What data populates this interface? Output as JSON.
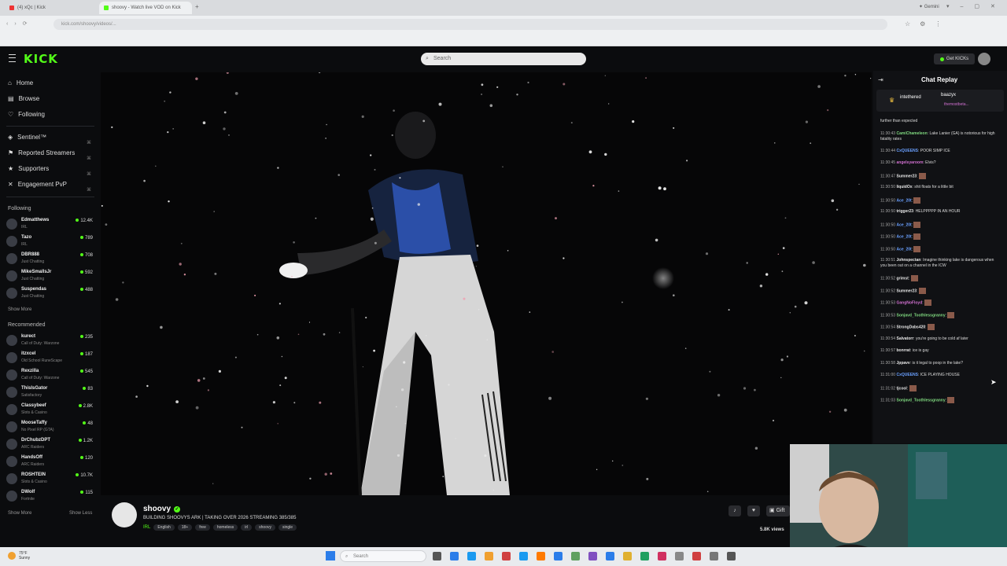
{
  "browser": {
    "tabs": [
      "(4) xQc | Kick",
      "shoovy - Watch live VOD on Kick"
    ],
    "profile": "Gemini",
    "url": "kick.com/shoovy/videos/..."
  },
  "header": {
    "logo": "KICK",
    "search_placeholder": "Search",
    "get_kicks": "Get KICKs"
  },
  "sidebar": {
    "nav": [
      {
        "label": "Home",
        "icon": "home-icon"
      },
      {
        "label": "Browse",
        "icon": "browse-icon"
      },
      {
        "label": "Following",
        "icon": "heart-icon"
      }
    ],
    "pinned": [
      {
        "label": "Sentinel™"
      },
      {
        "label": "Reported Streamers"
      },
      {
        "label": "Supporters"
      },
      {
        "label": "Engagement PvP"
      }
    ],
    "following_title": "Following",
    "following": [
      {
        "name": "Edmatthews",
        "category": "IRL",
        "viewers": "12.4K"
      },
      {
        "name": "Tazo",
        "category": "IRL",
        "viewers": "789"
      },
      {
        "name": "DBR888",
        "category": "Just Chatting",
        "viewers": "708"
      },
      {
        "name": "MikeSmallsJr",
        "category": "Just Chatting",
        "viewers": "592"
      },
      {
        "name": "Suspendas",
        "category": "Just Chatting",
        "viewers": "488"
      }
    ],
    "show_more": "Show More",
    "recommended_title": "Recommended",
    "recommended": [
      {
        "name": "kurect",
        "category": "Call of Duty: Warzone",
        "viewers": "235"
      },
      {
        "name": "itzxcel",
        "category": "Old School RuneScape",
        "viewers": "187"
      },
      {
        "name": "Rexzilla",
        "category": "Call of Duty: Warzone",
        "viewers": "545"
      },
      {
        "name": "ThisIsGator",
        "category": "Satisfactory",
        "viewers": "83"
      },
      {
        "name": "Classybeef",
        "category": "Slots & Casino",
        "viewers": "2.8K"
      },
      {
        "name": "MooseTaffy",
        "category": "No Pixel RP (GTA)",
        "viewers": "48"
      },
      {
        "name": "DrChubzDPT",
        "category": "ARC Raiders",
        "viewers": "1.2K"
      },
      {
        "name": "HandsOff",
        "category": "ARC Raiders",
        "viewers": "120"
      },
      {
        "name": "ROSHTEIN",
        "category": "Slots & Casino",
        "viewers": "10.7K"
      },
      {
        "name": "DWolf",
        "category": "Fortnite",
        "viewers": "115"
      }
    ],
    "show_more_2": "Show More",
    "show_less": "Show Less"
  },
  "stream": {
    "streamer": "shoovy",
    "title": "BUILDING SHOOVYS ARK | TAKING OVER 2026 STREAMING 385/385",
    "category": "IRL",
    "tags": [
      "English",
      "18+",
      "free",
      "homeless",
      "irl",
      "shoovy",
      "single"
    ],
    "views": "5.8K views",
    "gift": "Gift"
  },
  "chat": {
    "title": "Chat Replay",
    "pinned_users": [
      "intethered",
      "baazyx",
      "themostbeta..."
    ],
    "messages": [
      {
        "ts": "",
        "user": "",
        "text": "further than expected",
        "color": "#dddddd"
      },
      {
        "ts": "11:30:43",
        "user": "CamiChameleon",
        "text": "Lake Lanier (GA) is notorious for high fatality rates",
        "color": "#7fd87f"
      },
      {
        "ts": "11:30:44",
        "user": "CxQUEENS",
        "text": "POOR SIMP ICE",
        "color": "#6aa0ff"
      },
      {
        "ts": "11:30:45",
        "user": "angelsyaroom",
        "text": "Elvis?",
        "color": "#d070d0"
      },
      {
        "ts": "11:30:47",
        "user": "Summer23",
        "text": "",
        "color": "#e6e6e6"
      },
      {
        "ts": "11:30:50",
        "user": "liquidOx",
        "text": "shit floats for a little bit",
        "color": "#e6e6e6"
      },
      {
        "ts": "11:30:50",
        "user": "Ace_20t",
        "text": "",
        "color": "#6aa0ff"
      },
      {
        "ts": "11:30:50",
        "user": "trigger23",
        "text": "HELPPPPP IN AN HOUR",
        "color": "#e6e6e6"
      },
      {
        "ts": "11:30:50",
        "user": "Ace_20t",
        "text": "",
        "color": "#6aa0ff"
      },
      {
        "ts": "11:30:50",
        "user": "Ace_20t",
        "text": "",
        "color": "#6aa0ff"
      },
      {
        "ts": "11:30:50",
        "user": "Ace_20t",
        "text": "",
        "color": "#6aa0ff"
      },
      {
        "ts": "11:30:51",
        "user": "Johnspectan",
        "text": "Imagine thinking lake is dangerous when you been out on a channel in the ICW",
        "color": "#e6e6e6"
      },
      {
        "ts": "11:30:52",
        "user": "grimst",
        "text": "",
        "color": "#e6e6e6"
      },
      {
        "ts": "11:30:52",
        "user": "Summer23",
        "text": "",
        "color": "#e6e6e6"
      },
      {
        "ts": "11:30:53",
        "user": "GangNoFloyd",
        "text": "",
        "color": "#d070d0"
      },
      {
        "ts": "11:30:53",
        "user": "Sonjavd_Toothlessgranny",
        "text": "",
        "color": "#7fd87f"
      },
      {
        "ts": "11:30:54",
        "user": "StrongDabs420",
        "text": "",
        "color": "#e6e6e6"
      },
      {
        "ts": "11:30:54",
        "user": "Salvatorr",
        "text": "you're going to be cold af later",
        "color": "#e6e6e6"
      },
      {
        "ts": "11:30:57",
        "user": "bonrrat",
        "text": "ice is gay",
        "color": "#e6e6e6"
      },
      {
        "ts": "11:30:58",
        "user": "Jppavv",
        "text": "is it legal to poop in the lake?",
        "color": "#e6e6e6"
      },
      {
        "ts": "11:31:00",
        "user": "CxQUEENS",
        "text": "ICE PLAYING HOUSE",
        "color": "#6aa0ff"
      },
      {
        "ts": "11:31:02",
        "user": "tjcool",
        "text": "",
        "color": "#e6e6e6"
      },
      {
        "ts": "11:31:03",
        "user": "Sonjavd_Toothlessgranny",
        "text": "",
        "color": "#7fd87f"
      }
    ]
  },
  "taskbar": {
    "weather_temp": "75°F",
    "weather_desc": "Sunny",
    "search_placeholder": "Search"
  },
  "colors": {
    "kick_green": "#53fc18",
    "background": "#0b0c0e",
    "chat_bg": "#101114"
  }
}
